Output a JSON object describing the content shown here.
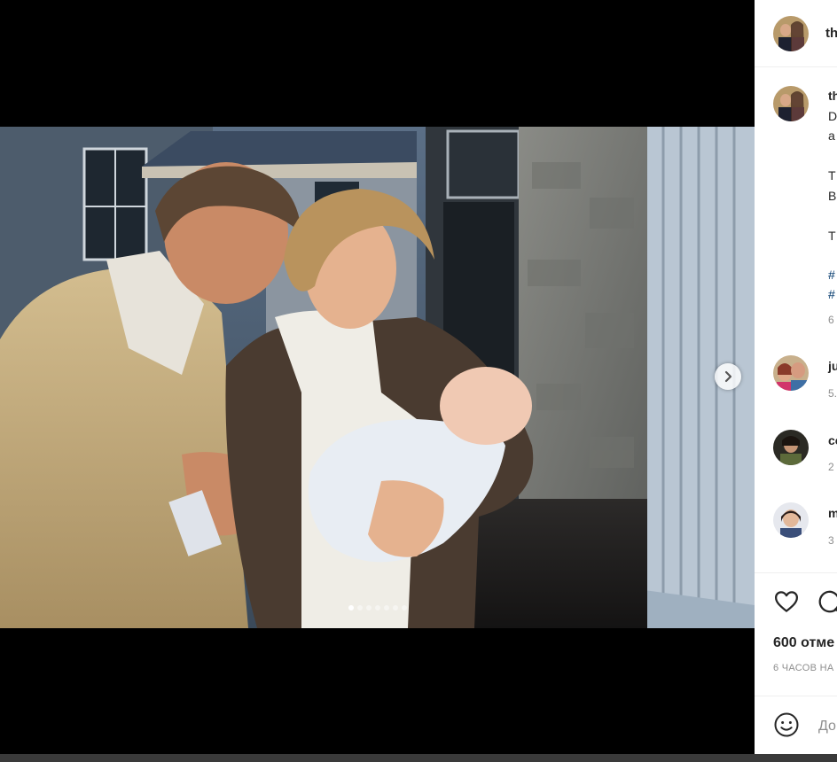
{
  "post": {
    "username": "th",
    "caption_lines": [
      "th",
      "D",
      "a",
      "T",
      "B",
      "T",
      "#",
      "#",
      "6"
    ],
    "slide_count": 7,
    "active_slide": 1
  },
  "comments": [
    {
      "username": "ju",
      "time": "5."
    },
    {
      "username": "co",
      "time": "2"
    },
    {
      "username": "m",
      "time": "3"
    }
  ],
  "actions": {
    "likes_text": "600 отме",
    "date_text": "6 ЧАСОВ НА",
    "comment_placeholder": "До"
  },
  "icons": {
    "next": "chevron-right-icon",
    "like": "heart-icon",
    "comment": "comment-icon",
    "emoji": "emoji-icon"
  }
}
